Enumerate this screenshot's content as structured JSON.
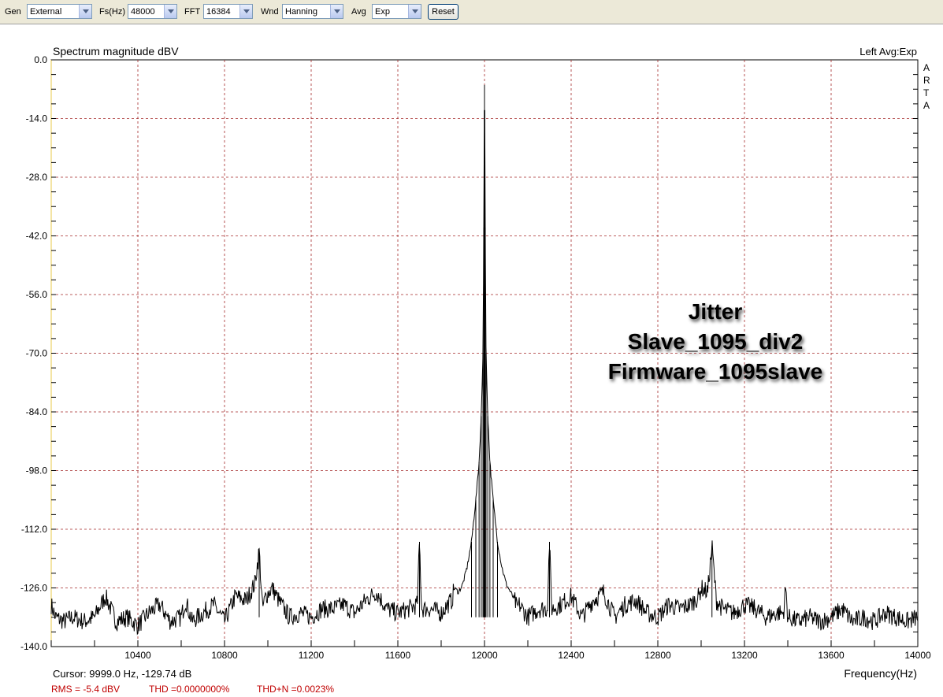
{
  "toolbar": {
    "gen_label": "Gen",
    "gen_value": "External",
    "fs_label": "Fs(Hz)",
    "fs_value": "48000",
    "fft_label": "FFT",
    "fft_value": "16384",
    "wnd_label": "Wnd",
    "wnd_value": "Hanning",
    "avg_label": "Avg",
    "avg_value": "Exp",
    "reset_label": "Reset"
  },
  "plot": {
    "channel_info": "Left  Avg:Exp",
    "brand_letters": [
      "A",
      "R",
      "T",
      "A"
    ],
    "cursor_text": "Cursor:  9999.0 Hz, -129.74 dB",
    "stats": {
      "rms": "RMS =   -5.4 dBV",
      "thd": "THD =0.0000000%",
      "thdn": "THD+N =0.0023%"
    },
    "annotation_lines": [
      "Jitter",
      "Slave_1095_div2",
      "Firmware_1095slave"
    ]
  },
  "colors": {
    "grid": "#a52a2a",
    "trace": "#000000",
    "stats": "#c00000",
    "toolbar_bg": "#ece9d8"
  },
  "chart_data": {
    "type": "line",
    "title": "Spectrum magnitude dBV",
    "xlabel": "Frequency(Hz)",
    "ylabel": "",
    "xlim": [
      10000,
      14000
    ],
    "ylim": [
      -140,
      0
    ],
    "x_ticks": [
      "10400",
      "10800",
      "11200",
      "11600",
      "12000",
      "12400",
      "12800",
      "13200",
      "13600",
      "14000"
    ],
    "y_ticks": [
      "0.0",
      "-14.0",
      "-28.0",
      "-42.0",
      "-56.0",
      "-70.0",
      "-84.0",
      "-98.0",
      "-112.0",
      "-126.0",
      "-140.0"
    ],
    "grid": true,
    "noise_floor_db": -133,
    "series": [
      {
        "points": [
          [
            10000,
            -130
          ],
          [
            10020,
            -133
          ],
          [
            10060,
            -134
          ],
          [
            10100,
            -133
          ],
          [
            10150,
            -134
          ],
          [
            10200,
            -133
          ],
          [
            10250,
            -128
          ],
          [
            10300,
            -134
          ],
          [
            10350,
            -133
          ],
          [
            10400,
            -135
          ],
          [
            10450,
            -132
          ],
          [
            10500,
            -130
          ],
          [
            10550,
            -134
          ],
          [
            10600,
            -133
          ],
          [
            10620,
            -129
          ],
          [
            10650,
            -134
          ],
          [
            10700,
            -132
          ],
          [
            10750,
            -130
          ],
          [
            10800,
            -134
          ],
          [
            10850,
            -128
          ],
          [
            10900,
            -129
          ],
          [
            10920,
            -127
          ],
          [
            10940,
            -125
          ],
          [
            10960,
            -117
          ],
          [
            10975,
            -131
          ],
          [
            10990,
            -128
          ],
          [
            11020,
            -126
          ],
          [
            11050,
            -129
          ],
          [
            11100,
            -133
          ],
          [
            11150,
            -132
          ],
          [
            11200,
            -133
          ],
          [
            11250,
            -131
          ],
          [
            11300,
            -131
          ],
          [
            11350,
            -130
          ],
          [
            11400,
            -132
          ],
          [
            11450,
            -129
          ],
          [
            11500,
            -127
          ],
          [
            11550,
            -131
          ],
          [
            11600,
            -132
          ],
          [
            11650,
            -131
          ],
          [
            11690,
            -130
          ],
          [
            11700,
            -115
          ],
          [
            11710,
            -131
          ],
          [
            11750,
            -131
          ],
          [
            11800,
            -132
          ],
          [
            11830,
            -130
          ],
          [
            11850,
            -129
          ],
          [
            11860,
            -126
          ],
          [
            11880,
            -127
          ],
          [
            11900,
            -125
          ],
          [
            11920,
            -121
          ],
          [
            11940,
            -115
          ],
          [
            11960,
            -105
          ],
          [
            11975,
            -96
          ],
          [
            11985,
            -85
          ],
          [
            11993,
            -70
          ],
          [
            11997,
            -40
          ],
          [
            11999,
            -12
          ],
          [
            12000,
            -6
          ],
          [
            12001,
            -12
          ],
          [
            12003,
            -40
          ],
          [
            12007,
            -70
          ],
          [
            12015,
            -85
          ],
          [
            12025,
            -96
          ],
          [
            12040,
            -105
          ],
          [
            12060,
            -115
          ],
          [
            12080,
            -121
          ],
          [
            12100,
            -125
          ],
          [
            12120,
            -127
          ],
          [
            12140,
            -129
          ],
          [
            12150,
            -131
          ],
          [
            12160,
            -130
          ],
          [
            12200,
            -133
          ],
          [
            12250,
            -131
          ],
          [
            12290,
            -131
          ],
          [
            12300,
            -115
          ],
          [
            12310,
            -131
          ],
          [
            12350,
            -130
          ],
          [
            12400,
            -128
          ],
          [
            12450,
            -133
          ],
          [
            12500,
            -129
          ],
          [
            12550,
            -127
          ],
          [
            12600,
            -133
          ],
          [
            12650,
            -130
          ],
          [
            12700,
            -129
          ],
          [
            12750,
            -132
          ],
          [
            12800,
            -133
          ],
          [
            12850,
            -130
          ],
          [
            12900,
            -131
          ],
          [
            12950,
            -130
          ],
          [
            12990,
            -128
          ],
          [
            13000,
            -126
          ],
          [
            13030,
            -127
          ],
          [
            13050,
            -116
          ],
          [
            13070,
            -129
          ],
          [
            13100,
            -131
          ],
          [
            13150,
            -132
          ],
          [
            13200,
            -130
          ],
          [
            13250,
            -131
          ],
          [
            13300,
            -133
          ],
          [
            13350,
            -132
          ],
          [
            13380,
            -132
          ],
          [
            13390,
            -126
          ],
          [
            13400,
            -133
          ],
          [
            13450,
            -134
          ],
          [
            13500,
            -133
          ],
          [
            13550,
            -134
          ],
          [
            13600,
            -133
          ],
          [
            13650,
            -131
          ],
          [
            13700,
            -134
          ],
          [
            13750,
            -133
          ],
          [
            13800,
            -134
          ],
          [
            13850,
            -132
          ],
          [
            13900,
            -133
          ],
          [
            13950,
            -134
          ],
          [
            14000,
            -133
          ]
        ]
      }
    ]
  }
}
